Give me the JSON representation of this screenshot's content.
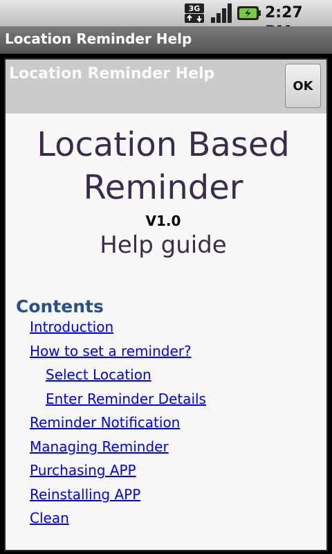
{
  "status_bar": {
    "network": "3G",
    "time": "2:27 PM",
    "icons": [
      "3g-data-icon",
      "signal-strength-icon",
      "battery-charging-icon"
    ]
  },
  "app": {
    "title": "Location Reminder Help"
  },
  "dialog": {
    "title": "Location Reminder Help",
    "ok_label": "OK",
    "heading": "Location Based Reminder",
    "version": "V1.0",
    "subtitle": "Help guide",
    "contents_heading": "Contents",
    "links": [
      {
        "label": "Introduction"
      },
      {
        "label": "How to set a reminder?"
      },
      {
        "label": "Select Location"
      },
      {
        "label": "Enter Reminder Details"
      },
      {
        "label": "Reminder Notification"
      },
      {
        "label": "Managing Reminder"
      },
      {
        "label": "Purchasing APP"
      },
      {
        "label": "Reinstalling APP"
      },
      {
        "label": "Clean"
      }
    ]
  },
  "colors": {
    "accent_green": "#7ac943",
    "link_blue": "#0000ee",
    "heading_purple": "#3a2d4c",
    "contents_blue": "#2b4f86"
  }
}
